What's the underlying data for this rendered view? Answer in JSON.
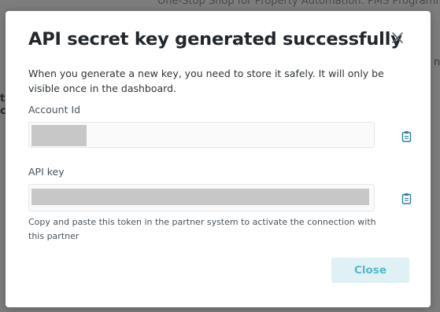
{
  "background": {
    "top_text": "One-Stop Shop for Property Automation: PMS Programmes"
  },
  "modal": {
    "title": "API secret key generated successfully",
    "description": "When you generate a new key, you need to store it safely. It will only be visible once in the dashboard.",
    "fields": [
      {
        "label": "Account Id",
        "value_state": "redacted"
      },
      {
        "label": "API key",
        "value_state": "redacted"
      }
    ],
    "helper_text": "Copy and paste this token in the partner system to activate the connection with this partner",
    "close_button_label": "Close"
  },
  "colors": {
    "accent_text": "#58b8c8",
    "accent_bg": "#dff1f4",
    "icon": "#2e7fa0",
    "redaction": "#c7c7c7"
  },
  "icons": {
    "close": "close-icon",
    "copy": "clipboard-icon"
  }
}
